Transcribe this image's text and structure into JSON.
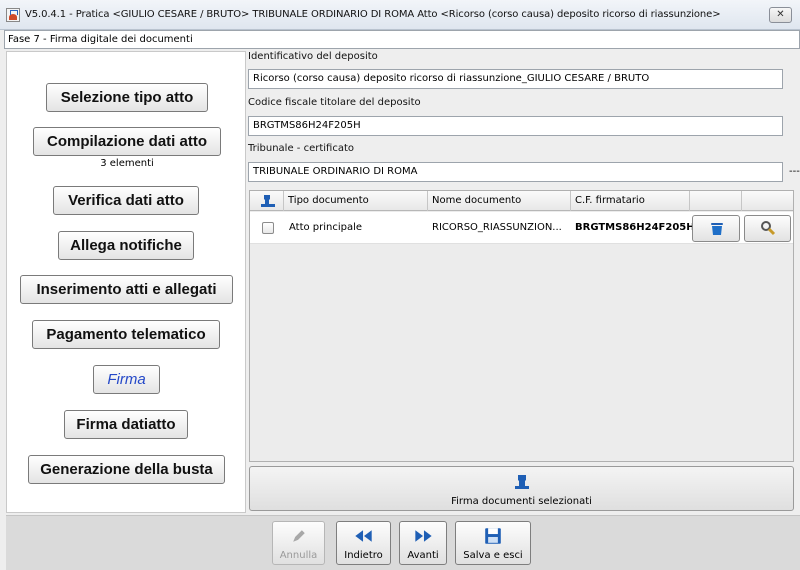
{
  "window": {
    "title": "V5.0.4.1 - Pratica <GIULIO CESARE / BRUTO>   TRIBUNALE ORDINARIO DI ROMA   Atto <Ricorso (corso causa) deposito ricorso di riassunzione>",
    "close_label": "✕"
  },
  "phase": "Fase 7 - Firma digitale dei documenti",
  "steps": [
    {
      "label": "Selezione tipo atto",
      "active": false
    },
    {
      "label": "Compilazione dati atto",
      "active": false,
      "note": "3 elementi"
    },
    {
      "label": "Verifica dati atto",
      "active": false
    },
    {
      "label": "Allega notifiche",
      "active": false
    },
    {
      "label": "Inserimento atti e allegati",
      "active": false
    },
    {
      "label": "Pagamento telematico",
      "active": false
    },
    {
      "label": "Firma",
      "active": true
    },
    {
      "label": "Firma datiatto",
      "active": false
    },
    {
      "label": "Generazione della busta",
      "active": false
    }
  ],
  "form": {
    "id_label": "Identificativo del deposito",
    "id_value": "Ricorso (corso causa) deposito ricorso di riassunzione_GIULIO CESARE / BRUTO",
    "cf_label": "Codice fiscale titolare del deposito",
    "cf_value": "BRGTMS86H24F205H",
    "court_label": "Tribunale - certificato",
    "court_value": "TRIBUNALE ORDINARIO DI ROMA",
    "dash": "---"
  },
  "table": {
    "columns": [
      "Tipo documento",
      "Nome documento",
      "C.F. firmatario"
    ],
    "rows": [
      {
        "tipo": "Atto principale",
        "nome": "RICORSO_RIASSUNZION...",
        "cf": "BRGTMS86H24F205H",
        "checked": false
      }
    ]
  },
  "sign_button": "Firma documenti selezionati",
  "footer": {
    "annulla": "Annulla",
    "indietro": "Indietro",
    "avanti": "Avanti",
    "salva": "Salva e esci"
  },
  "colors": {
    "accent_blue": "#1f5fb5",
    "active_step": "#2448c8"
  }
}
